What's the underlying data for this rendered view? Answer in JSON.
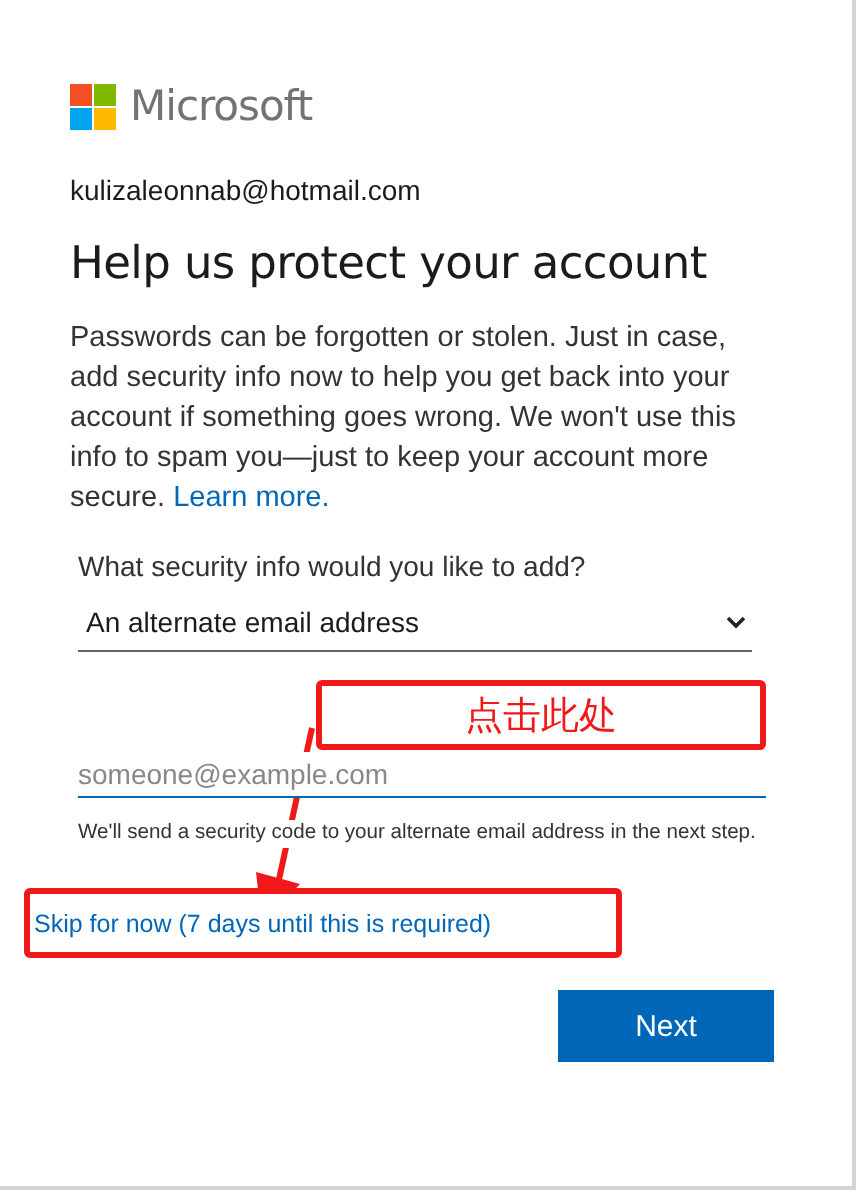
{
  "brand": {
    "name": "Microsoft"
  },
  "account": "kulizaleonnab@hotmail.com",
  "title": "Help us protect your account",
  "intro": {
    "text": "Passwords can be forgotten or stolen. Just in case, add security info now to help you get back into your account if something goes wrong. We won't use this info to spam you—just to keep your account more secure.",
    "link": "Learn more."
  },
  "security_choice": {
    "label": "What security info would you like to add?",
    "value": "An alternate email address"
  },
  "email_field": {
    "placeholder": "someone@example.com",
    "focused": true
  },
  "hint": "We'll send a security code to your alternate email address in the next step.",
  "skip_link": "Skip for now (7 days until this is required)",
  "buttons": [
    {
      "label": "Next",
      "kind": "primary"
    }
  ],
  "annotation": {
    "callout": "点击此处"
  }
}
